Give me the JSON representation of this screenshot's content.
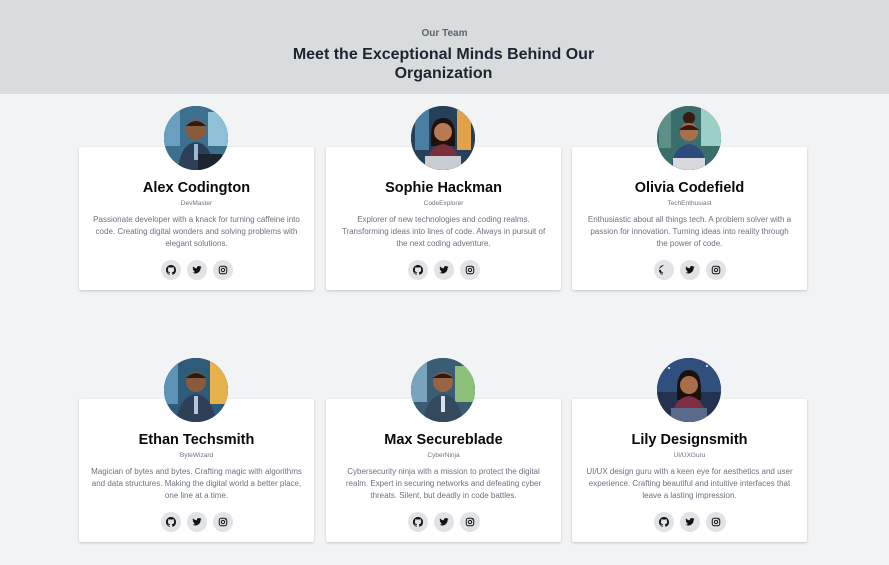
{
  "header": {
    "eyebrow": "Our Team",
    "title": "Meet the Exceptional Minds Behind Our Organization"
  },
  "team": [
    {
      "name": "Alex Codington",
      "role": "DevMaster",
      "bio": "Passionate developer with a knack for turning caffeine into code. Creating digital wonders and solving problems with elegant solutions."
    },
    {
      "name": "Sophie Hackman",
      "role": "CodeExplorer",
      "bio": "Explorer of new technologies and coding realms. Transforming ideas into lines of code. Always in pursuit of the next coding adventure."
    },
    {
      "name": "Olivia Codefield",
      "role": "TechEnthusiast",
      "bio": "Enthusiastic about all things tech. A problem solver with a passion for innovation. Turning ideas into reality through the power of code."
    },
    {
      "name": "Ethan Techsmith",
      "role": "ByteWizard",
      "bio": "Magician of bytes and bytes. Crafting magic with algorithms and data structures. Making the digital world a better place, one line at a time."
    },
    {
      "name": "Max Secureblade",
      "role": "CyberNinja",
      "bio": "Cybersecurity ninja with a mission to protect the digital realm. Expert in securing networks and defeating cyber threats. Silent, but deadly in code battles."
    },
    {
      "name": "Lily Designsmith",
      "role": "UI/UXGuru",
      "bio": "UI/UX design guru with a keen eye for aesthetics and user experience. Crafting beautiful and intuitive interfaces that leave a lasting impression."
    }
  ],
  "social_icons": [
    "github-icon",
    "twitter-icon",
    "instagram-icon"
  ],
  "colors": {
    "hero_background": "#d9dcdd",
    "page_background": "#f2f3f5",
    "card_background": "#ffffff",
    "social_button": "#e1e3e6"
  }
}
